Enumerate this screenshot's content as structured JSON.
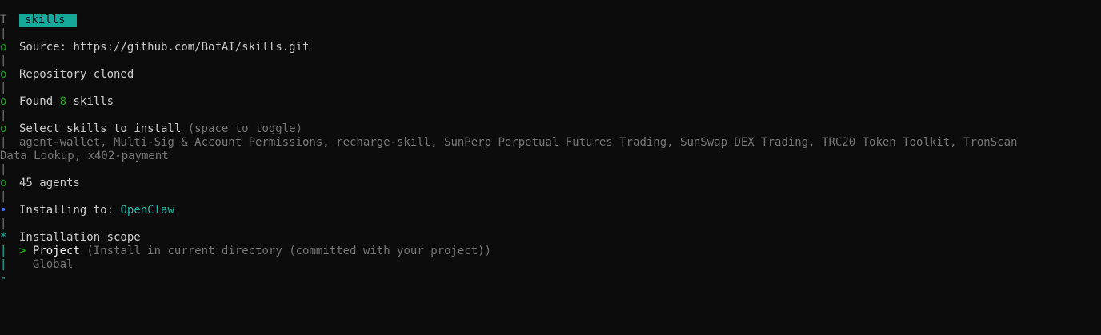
{
  "terminal": {
    "title": "skills",
    "source_label": "Source:",
    "source_url": "https://github.com/BofAI/skills.git",
    "repo_status": "Repository cloned",
    "found_prefix": "Found",
    "found_count": "8",
    "found_suffix": "skills",
    "select_prompt": "Select skills to install",
    "select_hint": "(space to toggle)",
    "selected_skills_line1": "agent-wallet, Multi-Sig & Account Permissions, recharge-skill, SunPerp Perpetual Futures Trading, SunSwap DEX Trading, TRC20 Token Toolkit, TronScan",
    "selected_skills_line2": "Data Lookup, x402-payment",
    "agents_line": "45 agents",
    "installing_label": "Installing to:",
    "installing_target": "OpenClaw",
    "scope_prompt": "Installation scope",
    "options": [
      {
        "marker": ">",
        "label": "Project",
        "hint": "(Install in current directory (committed with your project))"
      },
      {
        "marker": "",
        "label": "Global",
        "hint": ""
      }
    ]
  },
  "gutter": {
    "start": "T",
    "bar": "|",
    "done": "o",
    "active": "•",
    "question": "*",
    "end": "-"
  },
  "colors": {
    "background": "#0c0c0c",
    "badge": "#16a79b",
    "success": "#13a10e",
    "accent": "#1fb5a6",
    "muted": "#767676"
  }
}
